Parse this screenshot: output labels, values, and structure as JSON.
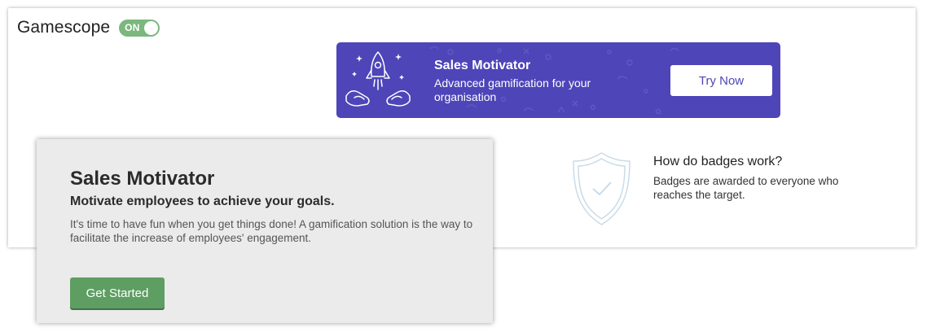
{
  "app": {
    "title": "Gamescope",
    "toggle_label": "ON",
    "toggle_state": "on"
  },
  "banner": {
    "title": "Sales Motivator",
    "subtitle": "Advanced gamification for your organisation",
    "cta_label": "Try Now",
    "background_color": "#4e45b8",
    "illustration_icon": "rocket-hands-icon"
  },
  "badges_info": {
    "title": "How do badges work?",
    "text": "Badges are awarded to everyone who reaches the target.",
    "icon": "shield-check-icon"
  },
  "intro_card": {
    "title": "Sales Motivator",
    "subtitle": "Motivate employees to achieve your goals.",
    "description": "It's time to have fun when you get things done! A gamification solution is the way to facilitate the increase of employees' engagement.",
    "cta_label": "Get Started",
    "cta_color": "#5e9e63"
  }
}
